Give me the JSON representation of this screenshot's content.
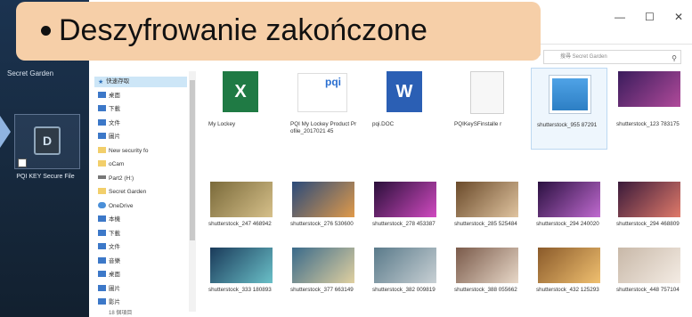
{
  "overlay": {
    "text": "Deszyfrowanie zakończone"
  },
  "desktop": {
    "window_title": "Secret Garden",
    "shortcut_label": "PQI KEY Secure File",
    "icon_glyph": "D"
  },
  "window": {
    "controls": {
      "minimize": "—",
      "maximize": "☐",
      "close": "✕"
    },
    "search_placeholder": "搜尋 Secret Garden",
    "search_icon": "search-icon",
    "refresh_icon": "refresh-icon"
  },
  "nav": {
    "items": [
      {
        "label": "快速存取",
        "icon": "star-icon",
        "selected": true
      },
      {
        "label": "桌面",
        "icon": "desktop-icon"
      },
      {
        "label": "下載",
        "icon": "download-icon"
      },
      {
        "label": "文件",
        "icon": "document-icon"
      },
      {
        "label": "圖片",
        "icon": "picture-icon"
      },
      {
        "label": "New security fo",
        "icon": "folder-icon"
      },
      {
        "label": "oCam",
        "icon": "folder-icon"
      },
      {
        "label": "Part2 (H:)",
        "icon": "drive-icon"
      },
      {
        "label": "Secret Garden",
        "icon": "folder-icon"
      },
      {
        "label": "OneDrive",
        "icon": "cloud-icon"
      },
      {
        "label": "本機",
        "icon": "pc-icon"
      },
      {
        "label": "下載",
        "icon": "download-icon"
      },
      {
        "label": "文件",
        "icon": "document-icon"
      },
      {
        "label": "音樂",
        "icon": "music-icon"
      },
      {
        "label": "桌面",
        "icon": "desktop-icon"
      },
      {
        "label": "圖片",
        "icon": "picture-icon"
      },
      {
        "label": "影片",
        "icon": "video-icon"
      }
    ],
    "status": "18 個項目"
  },
  "files": [
    {
      "name": "My Lockey",
      "type": "excel"
    },
    {
      "name": "PQI My Lockey Product Profile_2017021 45",
      "type": "ppt"
    },
    {
      "name": "pqi.DOC",
      "type": "word"
    },
    {
      "name": "PQIKeySFinstalle r",
      "type": "blank"
    },
    {
      "name": "shutterstock_955 87291",
      "type": "image-placeholder"
    },
    {
      "name": "shutterstock_123 783175",
      "type": "photo",
      "colors": [
        "#3a1c5c",
        "#b04a9a"
      ]
    },
    {
      "name": "shutterstock_247 468942",
      "type": "photo",
      "colors": [
        "#7a6a3a",
        "#d6c08a"
      ]
    },
    {
      "name": "shutterstock_276 530600",
      "type": "photo",
      "colors": [
        "#2a4a7a",
        "#e09a4a"
      ]
    },
    {
      "name": "shutterstock_278 453387",
      "type": "photo",
      "colors": [
        "#2a0f3a",
        "#d04ac0"
      ]
    },
    {
      "name": "shutterstock_285 525484",
      "type": "photo",
      "colors": [
        "#6a4a2a",
        "#e0c4a0"
      ]
    },
    {
      "name": "shutterstock_294 240020",
      "type": "photo",
      "colors": [
        "#2a1040",
        "#c06ad0"
      ]
    },
    {
      "name": "shutterstock_294 468809",
      "type": "photo",
      "colors": [
        "#3a1a3a",
        "#e07a6a"
      ]
    },
    {
      "name": "shutterstock_333 180893",
      "type": "photo",
      "colors": [
        "#1a3a5a",
        "#6ac0c8"
      ]
    },
    {
      "name": "shutterstock_377 663149",
      "type": "photo",
      "colors": [
        "#3a6a8a",
        "#e0d0a0"
      ]
    },
    {
      "name": "shutterstock_382 009819",
      "type": "photo",
      "colors": [
        "#5a7a8a",
        "#c8d0d4"
      ]
    },
    {
      "name": "shutterstock_388 055662",
      "type": "photo",
      "colors": [
        "#7a5a4a",
        "#e8d8c8"
      ]
    },
    {
      "name": "shutterstock_432 125293",
      "type": "photo",
      "colors": [
        "#8a5a2a",
        "#f0c070"
      ]
    },
    {
      "name": "shutterstock_448 757104",
      "type": "photo",
      "colors": [
        "#c8b8a8",
        "#f4ece4"
      ]
    }
  ]
}
